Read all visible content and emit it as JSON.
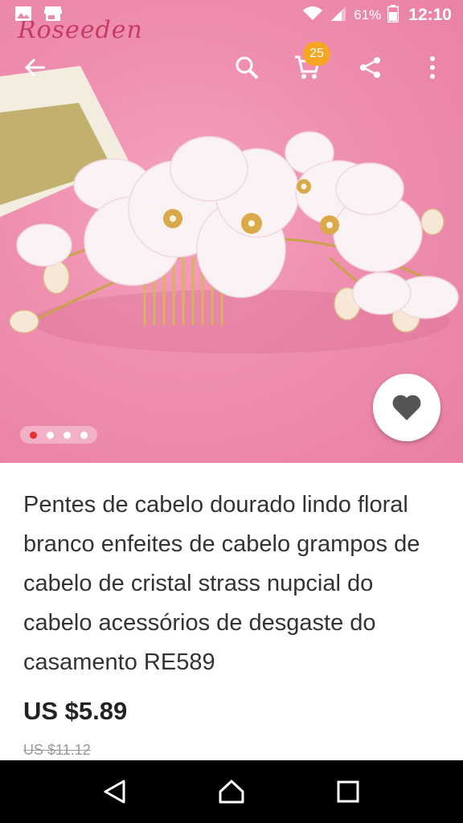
{
  "status_bar": {
    "battery_percent": "61%",
    "time": "12:10",
    "icons": [
      "image-icon",
      "store-icon",
      "wifi-icon",
      "signal-icon",
      "battery-icon"
    ]
  },
  "watermark": {
    "text": "Roseeden"
  },
  "action_bar": {
    "icons": [
      "back-arrow-icon",
      "search-icon",
      "cart-icon",
      "share-icon",
      "more-vertical-icon"
    ],
    "cart_count": "25"
  },
  "carousel": {
    "dot_count": 4,
    "active_index": 0
  },
  "product": {
    "title": "Pentes de cabelo dourado lindo floral branco enfeites de cabelo grampos de cabelo de cristal strass nupcial do cabelo acessórios de desgaste do casamento RE589",
    "price": "US $5.89",
    "original_price": "US $11.12"
  },
  "nav_bar": {
    "icons": [
      "back-triangle-icon",
      "home-icon",
      "recents-icon"
    ]
  },
  "colors": {
    "hero_pink": "#ef8fb0",
    "badge_orange": "#f5a623",
    "active_dot_red": "#e8312d",
    "price_text": "#222222"
  }
}
